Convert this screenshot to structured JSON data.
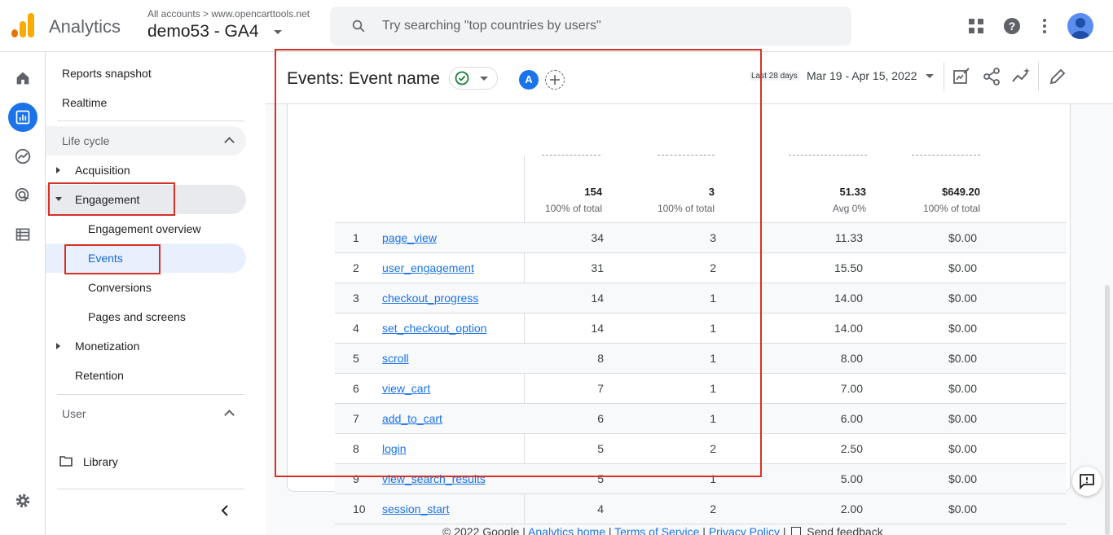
{
  "header": {
    "app_name": "Analytics",
    "account_crumb": "All accounts > www.opencarttools.net",
    "property": "demo53 - GA4",
    "search_placeholder": "Try searching \"top countries by users\""
  },
  "nav": {
    "reports_snapshot": "Reports snapshot",
    "realtime": "Realtime",
    "lifecycle": "Life cycle",
    "acquisition": "Acquisition",
    "engagement": "Engagement",
    "engagement_overview": "Engagement overview",
    "events": "Events",
    "conversions": "Conversions",
    "pages_and_screens": "Pages and screens",
    "monetization": "Monetization",
    "retention": "Retention",
    "user": "User",
    "library": "Library"
  },
  "report": {
    "title": "Events: Event name",
    "comparison_letter": "A",
    "last_days": "Last 28 days",
    "date_range": "Mar 19 - Apr 15, 2022"
  },
  "totals": [
    {
      "value": "154",
      "sub": "100% of total"
    },
    {
      "value": "3",
      "sub": "100% of total"
    },
    {
      "value": "51.33",
      "sub": "Avg 0%"
    },
    {
      "value": "$649.20",
      "sub": "100% of total"
    }
  ],
  "rows": [
    {
      "idx": "1",
      "event": "page_view",
      "count": "34",
      "users": "3",
      "per_user": "11.33",
      "revenue": "$0.00"
    },
    {
      "idx": "2",
      "event": "user_engagement",
      "count": "31",
      "users": "2",
      "per_user": "15.50",
      "revenue": "$0.00"
    },
    {
      "idx": "3",
      "event": "checkout_progress",
      "count": "14",
      "users": "1",
      "per_user": "14.00",
      "revenue": "$0.00"
    },
    {
      "idx": "4",
      "event": "set_checkout_option",
      "count": "14",
      "users": "1",
      "per_user": "14.00",
      "revenue": "$0.00"
    },
    {
      "idx": "5",
      "event": "scroll",
      "count": "8",
      "users": "1",
      "per_user": "8.00",
      "revenue": "$0.00"
    },
    {
      "idx": "6",
      "event": "view_cart",
      "count": "7",
      "users": "1",
      "per_user": "7.00",
      "revenue": "$0.00"
    },
    {
      "idx": "7",
      "event": "add_to_cart",
      "count": "6",
      "users": "1",
      "per_user": "6.00",
      "revenue": "$0.00"
    },
    {
      "idx": "8",
      "event": "login",
      "count": "5",
      "users": "2",
      "per_user": "2.50",
      "revenue": "$0.00"
    },
    {
      "idx": "9",
      "event": "view_search_results",
      "count": "5",
      "users": "1",
      "per_user": "5.00",
      "revenue": "$0.00"
    },
    {
      "idx": "10",
      "event": "session_start",
      "count": "4",
      "users": "2",
      "per_user": "2.00",
      "revenue": "$0.00"
    }
  ],
  "footer": {
    "copyright": "© 2022 Google |",
    "analytics_home": "Analytics home",
    "sep1": "|",
    "terms": "Terms of Service",
    "sep2": "|",
    "privacy": "Privacy Policy",
    "sep3": "|",
    "send_feedback": "Send feedback"
  },
  "colors": {
    "accent": "#1a73e8",
    "highlight": "#d93025",
    "logo_orange": "#f9ab00"
  }
}
